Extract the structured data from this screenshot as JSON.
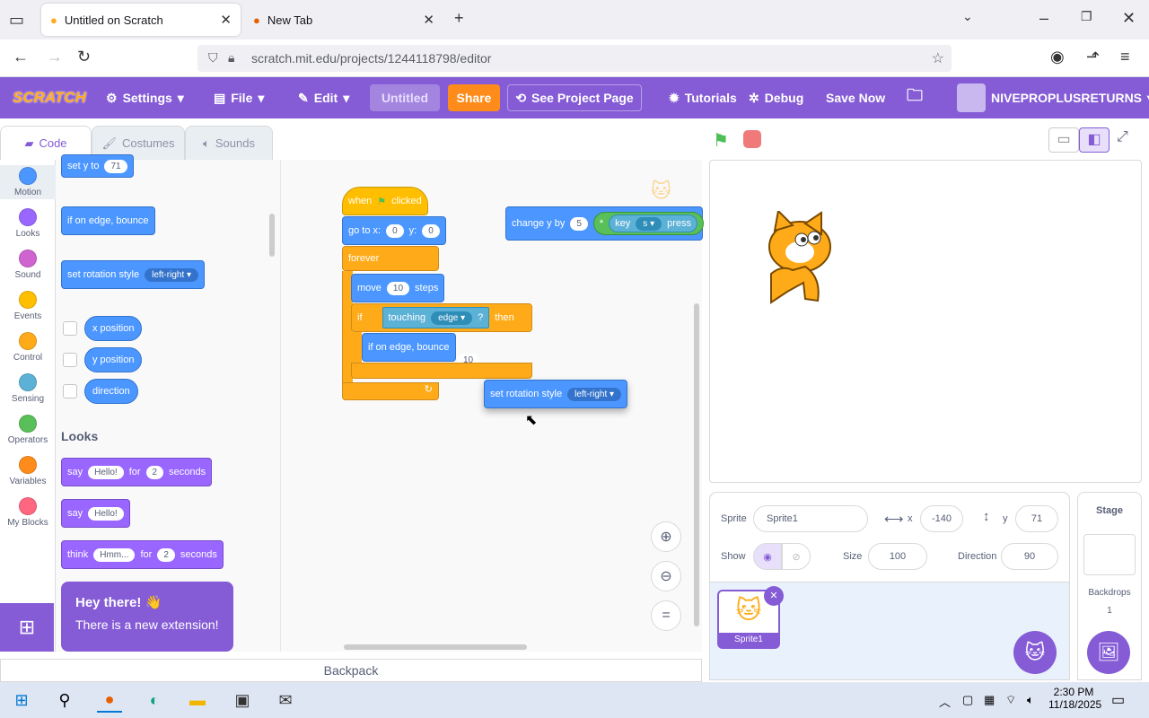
{
  "browser": {
    "tabs": [
      {
        "label": "Untitled on Scratch"
      },
      {
        "label": "New Tab"
      }
    ],
    "url": "scratch.mit.edu/projects/1244118798/editor"
  },
  "menubar": {
    "logo": "SCRATCH",
    "settings": "Settings",
    "file": "File",
    "edit": "Edit",
    "title": "Untitled",
    "share": "Share",
    "see_project": "See Project Page",
    "tutorials": "Tutorials",
    "debug": "Debug",
    "save_now": "Save Now",
    "username": "NIVEPROPLUSRETURNS"
  },
  "editor_tabs": {
    "code": "Code",
    "costumes": "Costumes",
    "sounds": "Sounds"
  },
  "categories": [
    {
      "label": "Motion",
      "color": "#4c97ff"
    },
    {
      "label": "Looks",
      "color": "#9966ff"
    },
    {
      "label": "Sound",
      "color": "#cf63cf"
    },
    {
      "label": "Events",
      "color": "#ffbf00"
    },
    {
      "label": "Control",
      "color": "#ffab19"
    },
    {
      "label": "Sensing",
      "color": "#5cb1d6"
    },
    {
      "label": "Operators",
      "color": "#59c059"
    },
    {
      "label": "Variables",
      "color": "#ff8c1a"
    },
    {
      "label": "My Blocks",
      "color": "#ff6680"
    }
  ],
  "palette": {
    "set_y": "set y to",
    "set_y_val": "71",
    "bounce": "if on edge, bounce",
    "rotation": "set rotation style",
    "rotation_val": "left-right",
    "xpos": "x position",
    "ypos": "y position",
    "direction": "direction",
    "looks_heading": "Looks",
    "say_for": "say",
    "say_for_val": "Hello!",
    "for_word": "for",
    "secs_val": "2",
    "seconds": "seconds",
    "say": "say",
    "say_val": "Hello!",
    "think": "think",
    "think_val": "Hmm...",
    "think_secs": "2"
  },
  "script": {
    "when": "when",
    "clicked": "clicked",
    "goto": "go to x:",
    "x_val": "0",
    "y_lbl": "y:",
    "y_val": "0",
    "forever": "forever",
    "move": "move",
    "move_val": "10",
    "steps": "steps",
    "if": "if",
    "touching": "touching",
    "touching_val": "edge",
    "q": "?",
    "then": "then",
    "bounce": "if on edge, bounce",
    "hidden_val": "10",
    "dragged": "set rotation style",
    "dragged_val": "left-right",
    "change_y": "change y by",
    "change_y_val": "5",
    "times": "*",
    "key": "key",
    "key_val": "s",
    "pressed": "press"
  },
  "sprite_info": {
    "sprite_lbl": "Sprite",
    "sprite_name": "Sprite1",
    "x_lbl": "x",
    "x": "-140",
    "y_lbl": "y",
    "y": "71",
    "show_lbl": "Show",
    "size_lbl": "Size",
    "size": "100",
    "direction_lbl": "Direction",
    "direction": "90",
    "thumb_name": "Sprite1"
  },
  "stage_pane": {
    "title": "Stage",
    "backdrops_lbl": "Backdrops",
    "backdrops_count": "1"
  },
  "tooltip": {
    "title": "Hey there! 👋",
    "body": "There is a new extension!"
  },
  "backpack": "Backpack",
  "taskbar": {
    "time": "2:30 PM",
    "date": "11/18/2025"
  }
}
